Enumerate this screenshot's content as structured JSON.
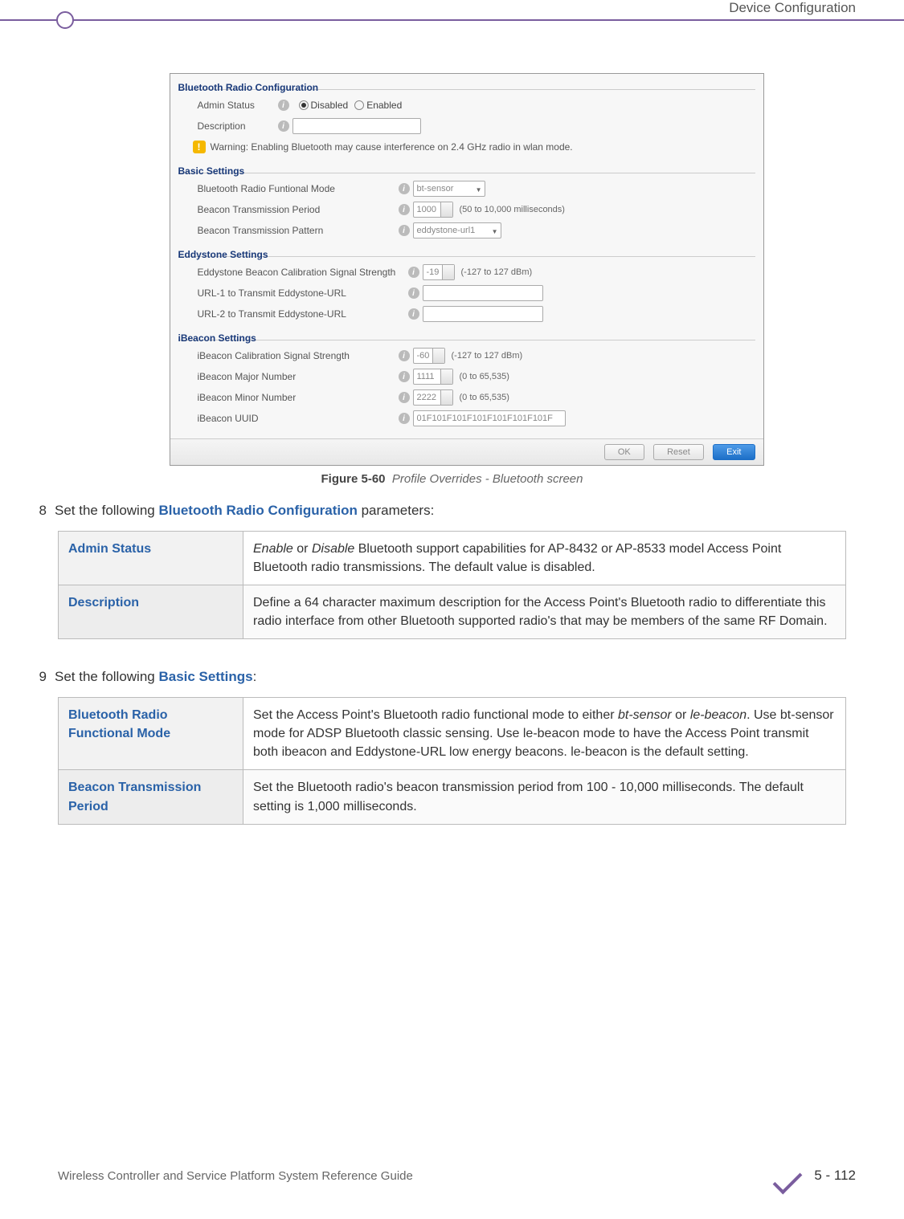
{
  "header": {
    "section": "Device Configuration"
  },
  "screenshot": {
    "bluetooth_radio_config": {
      "legend": "Bluetooth Radio Configuration",
      "admin_status_label": "Admin Status",
      "disabled_label": "Disabled",
      "enabled_label": "Enabled",
      "checked": "disabled",
      "description_label": "Description",
      "warning": "Warning: Enabling Bluetooth may cause interference on 2.4 GHz radio in wlan mode."
    },
    "basic_settings": {
      "legend": "Basic Settings",
      "functional_mode_label": "Bluetooth Radio Funtional Mode",
      "functional_mode_value": "bt-sensor",
      "beacon_period_label": "Beacon Transmission Period",
      "beacon_period_value": "1000",
      "beacon_period_hint": "(50 to 10,000 milliseconds)",
      "beacon_pattern_label": "Beacon Transmission Pattern",
      "beacon_pattern_value": "eddystone-url1"
    },
    "eddystone": {
      "legend": "Eddystone Settings",
      "cal_label": "Eddystone Beacon Calibration Signal Strength",
      "cal_value": "-19",
      "cal_hint": "(-127 to 127 dBm)",
      "url1_label": "URL-1 to Transmit Eddystone-URL",
      "url2_label": "URL-2 to Transmit Eddystone-URL"
    },
    "ibeacon": {
      "legend": "iBeacon Settings",
      "cal_label": "iBeacon Calibration Signal Strength",
      "cal_value": "-60",
      "cal_hint": "(-127 to 127 dBm)",
      "major_label": "iBeacon Major Number",
      "major_value": "1111",
      "major_hint": "(0 to 65,535)",
      "minor_label": "iBeacon Minor Number",
      "minor_value": "2222",
      "minor_hint": "(0 to 65,535)",
      "uuid_label": "iBeacon UUID",
      "uuid_value": "01F101F101F101F101F101F101F"
    },
    "buttons": {
      "ok": "OK",
      "reset": "Reset",
      "exit": "Exit"
    }
  },
  "caption": {
    "fig_label": "Figure 5-60",
    "fig_title": "Profile Overrides - Bluetooth screen"
  },
  "step8": {
    "num": "8",
    "text_before": "Set the following ",
    "strong": "Bluetooth Radio Configuration",
    "text_after": " parameters:"
  },
  "table8": {
    "r1_name": "Admin Status",
    "r1_desc_em1": "Enable",
    "r1_desc_mid1": " or ",
    "r1_desc_em2": "Disable",
    "r1_desc_rest": " Bluetooth support capabilities for AP-8432 or AP-8533 model Access Point Bluetooth radio transmissions. The default value is disabled.",
    "r2_name": "Description",
    "r2_desc": "Define a 64 character maximum description for the Access Point's Bluetooth radio to differentiate this radio interface from other Bluetooth supported radio's that may be members of the same RF Domain."
  },
  "step9": {
    "num": "9",
    "text_before": "Set the following ",
    "strong": "Basic Settings",
    "text_after": ":"
  },
  "table9": {
    "r1_name": "Bluetooth Radio Functional Mode",
    "r1_a": "Set the Access Point's Bluetooth radio functional mode to either ",
    "r1_em1": "bt-sensor",
    "r1_b": " or ",
    "r1_em2": "le-beacon",
    "r1_c": ". Use bt-sensor mode for ADSP Bluetooth classic sensing. Use le-beacon mode to have the Access Point transmit both ibeacon and Eddystone-URL low energy beacons. le-beacon is the default setting.",
    "r2_name": "Beacon Transmission Period",
    "r2_desc": "Set the Bluetooth radio's beacon transmission period from 100 - 10,000 milliseconds. The default setting is 1,000 milliseconds."
  },
  "footer": {
    "left": "Wireless Controller and Service Platform System Reference Guide",
    "page": "5 - 112"
  }
}
